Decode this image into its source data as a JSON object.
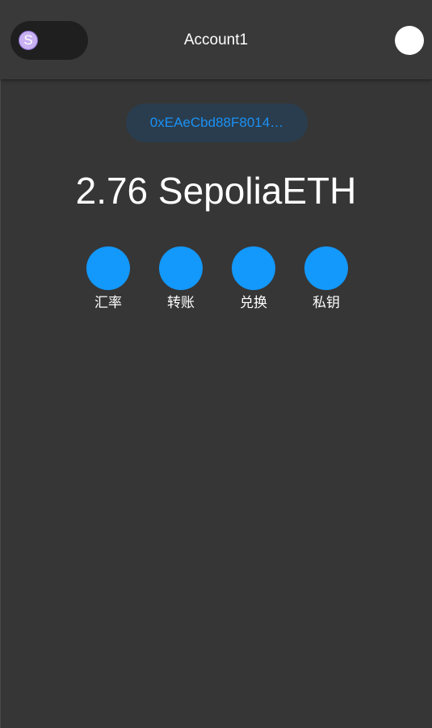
{
  "header": {
    "network_icon_letter": "S",
    "account_name": "Account1"
  },
  "wallet": {
    "address": "0xEAeCbd88F8014…",
    "balance": "2.76 SepoliaETH"
  },
  "actions": [
    {
      "label": "汇率"
    },
    {
      "label": "转账"
    },
    {
      "label": "兑换"
    },
    {
      "label": "私钥"
    }
  ],
  "colors": {
    "background": "#363636",
    "header": "#393939",
    "accent": "#1398fb",
    "address_text": "#1a91f5",
    "address_chip": "#2a3d4e",
    "network_icon": "#c9b1f2"
  }
}
